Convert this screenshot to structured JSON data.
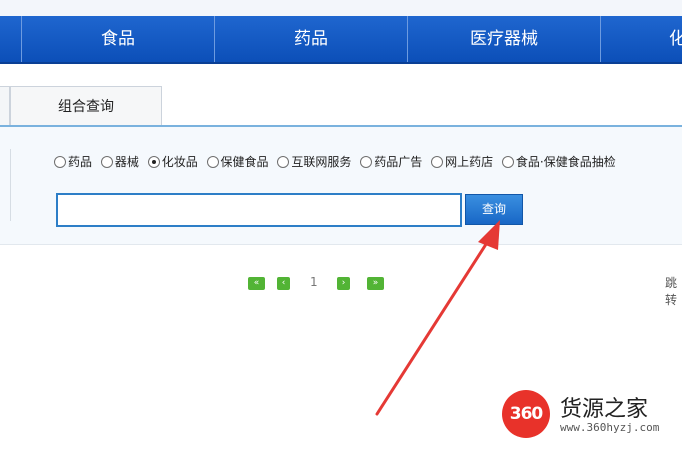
{
  "nav": {
    "items": [
      {
        "label": ""
      },
      {
        "label": "食品"
      },
      {
        "label": "药品"
      },
      {
        "label": "医疗器械"
      },
      {
        "label": "化"
      }
    ]
  },
  "tabs": {
    "active_label": "组合查询"
  },
  "search": {
    "categories": [
      {
        "label": "药品",
        "checked": false
      },
      {
        "label": "器械",
        "checked": false
      },
      {
        "label": "化妆品",
        "checked": true
      },
      {
        "label": "保健食品",
        "checked": false
      },
      {
        "label": "互联网服务",
        "checked": false
      },
      {
        "label": "药品广告",
        "checked": false
      },
      {
        "label": "网上药店",
        "checked": false
      },
      {
        "label": "食品·保健食品抽检",
        "checked": false
      }
    ],
    "input_value": "",
    "button_label": "查询"
  },
  "pager": {
    "first_symbol": "«",
    "prev_symbol": "‹",
    "current_page": "1",
    "next_symbol": "›",
    "last_symbol": "»",
    "jump_label": "跳转"
  },
  "annotation": {
    "arrow_color": "#e53935"
  },
  "watermark": {
    "badge": "360",
    "title": "货源之家",
    "url": "www.360hyzj.com"
  }
}
